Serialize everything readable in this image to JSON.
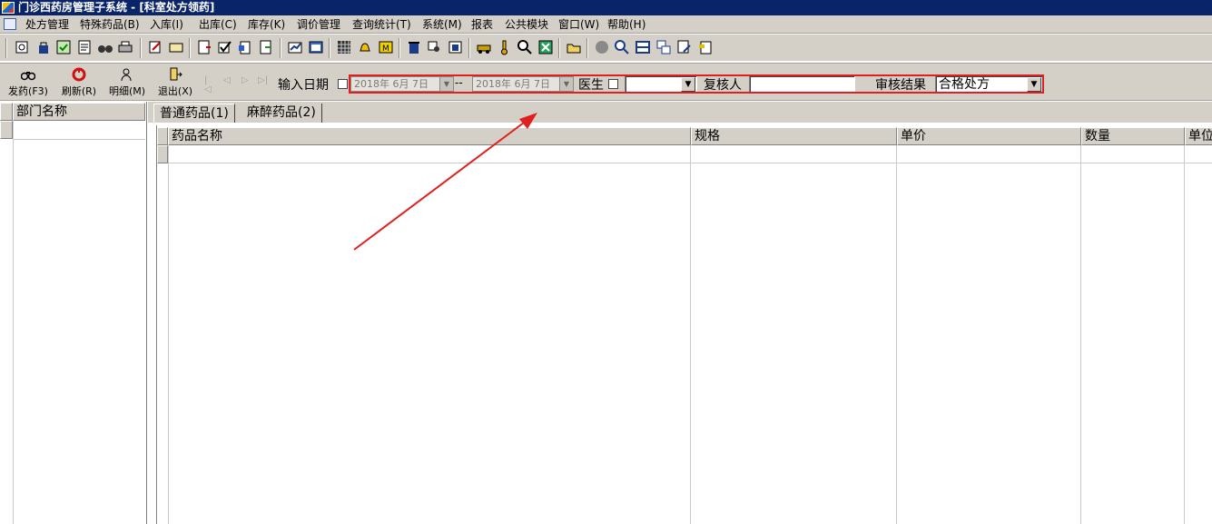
{
  "window": {
    "title": "门诊西药房管理子系统 - [科室处方领药]"
  },
  "menu": {
    "items": [
      "处方管理",
      "特殊药品(B)",
      "入库(I)",
      "出库(C)",
      "库存(K)",
      "调价管理",
      "查询统计(T)",
      "系统(M)",
      "报表",
      "公共模块",
      "窗口(W)",
      "帮助(H)"
    ]
  },
  "toolbar": {
    "icons": [
      "print-preview-icon",
      "lock-icon",
      "checkbox-icon",
      "document-icon",
      "binoculars-icon",
      "print-icon",
      "edit-icon",
      "card-icon",
      "notepad-icon",
      "checkmark-icon",
      "clipboard-icon",
      "refresh-icon",
      "chart-icon",
      "window-icon",
      "grid-icon",
      "bell-icon",
      "money-icon",
      "trash-icon",
      "search-icon",
      "transfer-icon",
      "car-icon",
      "thermometer-icon",
      "magnifier-icon",
      "excel-icon",
      "folder-icon",
      "stop-icon",
      "zoom-icon",
      "table-icon",
      "copy-icon",
      "edit2-icon",
      "paste-icon"
    ]
  },
  "actions": {
    "dispense": "发药(F3)",
    "refresh": "刷新(R)",
    "detail": "明细(M)",
    "exit": "退出(X)"
  },
  "filters": {
    "date_label": "输入日期",
    "date_from": "2018年 6月 7日",
    "date_sep": "--",
    "date_to": "2018年 6月 7日",
    "doctor_label": "医生",
    "doctor_value": "",
    "reviewer_label": "复核人",
    "reviewer_value": "",
    "result_label": "审核结果",
    "result_value": "合格处方"
  },
  "left_panel": {
    "header": "部门名称"
  },
  "tabs": [
    {
      "label": "普通药品(1)",
      "selected": true
    },
    {
      "label": "麻醉药品(2)",
      "selected": false
    }
  ],
  "grid": {
    "columns": [
      "药品名称",
      "规格",
      "单价",
      "数量",
      "单位"
    ]
  },
  "colors": {
    "titlebar": "#0a246a",
    "chrome": "#d4d0c8",
    "annotation": "#e02020"
  }
}
